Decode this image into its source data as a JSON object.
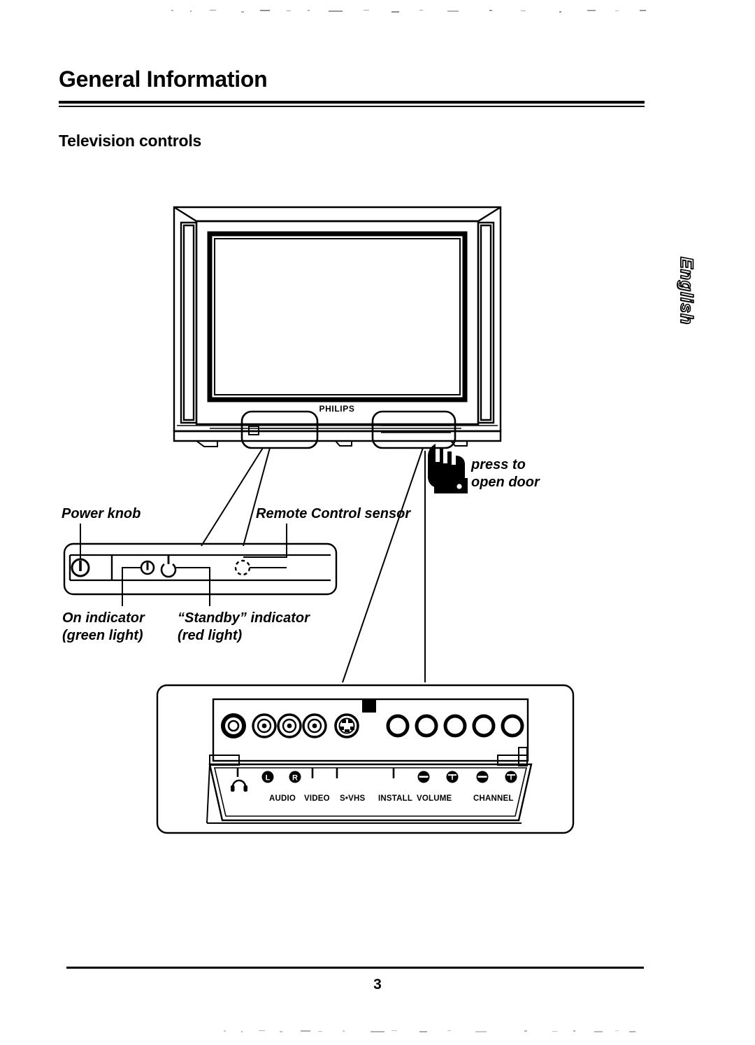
{
  "document": {
    "page_title": "General Information",
    "section_title": "Television controls",
    "side_tab": "English",
    "page_number": "3"
  },
  "tv": {
    "brand_logo": "PHILIPS"
  },
  "annotations": {
    "press_to_open_door_line1": "press to",
    "press_to_open_door_line2": "open door",
    "power_knob": "Power knob",
    "remote_control_sensor": "Remote Control sensor",
    "on_indicator_line1": "On indicator",
    "on_indicator_line2": "(green light)",
    "standby_indicator_line1": "“Standby” indicator",
    "standby_indicator_line2": "(red light)"
  },
  "control_panel": {
    "power_symbol": "power-on-icon",
    "on_indicator_symbol": "power-on-icon",
    "standby_symbol": "standby-icon",
    "ir_sensor_symbol": "ir-sensor-dashed-circle"
  },
  "connector_panel": {
    "jacks": [
      {
        "name": "headphone-jack",
        "label": "",
        "type": "headphone"
      },
      {
        "name": "audio-left-jack",
        "label": "L",
        "type": "rca"
      },
      {
        "name": "audio-right-jack",
        "label": "R",
        "type": "rca"
      },
      {
        "name": "video-jack",
        "label": "",
        "type": "rca"
      },
      {
        "name": "svhs-jack",
        "label": "",
        "type": "mini-din"
      }
    ],
    "buttons": [
      {
        "name": "install-button",
        "symbol": ""
      },
      {
        "name": "volume-down-button",
        "symbol": "−"
      },
      {
        "name": "volume-up-button",
        "symbol": "+"
      },
      {
        "name": "channel-down-button",
        "symbol": "−"
      },
      {
        "name": "channel-up-button",
        "symbol": "+"
      }
    ],
    "labels": {
      "headphone": "",
      "audio": "AUDIO",
      "audio_left": "L",
      "audio_right": "R",
      "video": "VIDEO",
      "svhs": "S•VHS",
      "install": "INSTALL",
      "volume": "VOLUME",
      "channel": "CHANNEL"
    }
  },
  "colors": {
    "ink": "#000000",
    "paper": "#ffffff"
  }
}
